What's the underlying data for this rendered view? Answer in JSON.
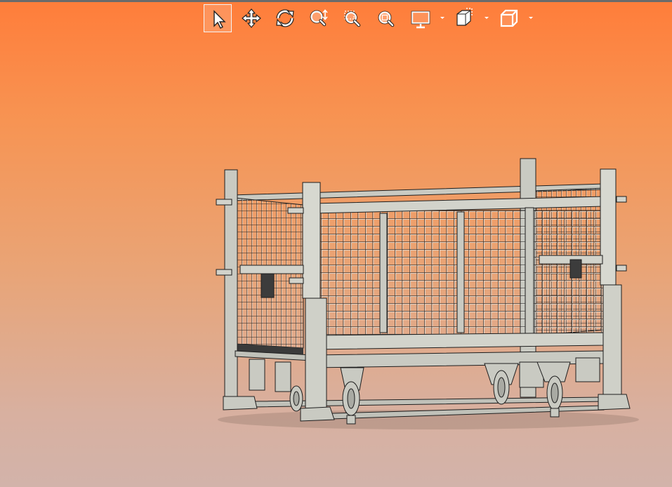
{
  "viewer": {
    "background": {
      "top": "#ff7d3a",
      "bottom": "#d2b3aa"
    },
    "accent": "#ffffff",
    "model_color": "#c9cac2"
  },
  "toolbar": {
    "tools": [
      {
        "icon": "select-arrow-icon",
        "state": "active"
      },
      {
        "icon": "pan-move-icon"
      },
      {
        "icon": "rotate-icon"
      },
      {
        "icon": "zoom-icon"
      },
      {
        "icon": "zoom-window-icon"
      },
      {
        "icon": "zoom-fit-icon"
      },
      {
        "icon": "display-mode-icon",
        "has_dropdown": true
      },
      {
        "icon": "section-view-icon",
        "has_dropdown": true
      },
      {
        "icon": "standard-views-cube-icon",
        "has_dropdown": true
      }
    ]
  },
  "model": {
    "icon": "wire-mesh-pallet-cage-on-casters-icon"
  }
}
